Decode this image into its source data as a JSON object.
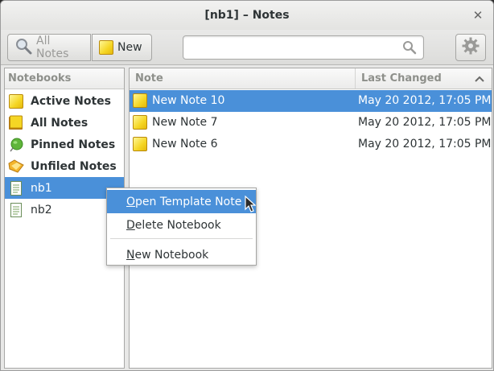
{
  "window": {
    "title": "[nb1] – Notes",
    "close_label": "✕"
  },
  "toolbar": {
    "all_notes_label": "All Notes",
    "new_label": "New",
    "search": {
      "value": "",
      "placeholder": ""
    }
  },
  "notebooks": {
    "header": "Notebooks",
    "items": [
      {
        "label": "Active Notes",
        "icon": "note-icon",
        "bold": true,
        "selected": false
      },
      {
        "label": "All Notes",
        "icon": "notebook-icon",
        "bold": true,
        "selected": false
      },
      {
        "label": "Pinned Notes",
        "icon": "pin-icon",
        "bold": true,
        "selected": false
      },
      {
        "label": "Unfiled Notes",
        "icon": "folder-icon",
        "bold": true,
        "selected": false
      },
      {
        "label": "nb1",
        "icon": "notebook-doc-icon",
        "bold": false,
        "selected": true
      },
      {
        "label": "nb2",
        "icon": "notebook-doc-icon",
        "bold": false,
        "selected": false
      }
    ]
  },
  "notes": {
    "columns": {
      "note": "Note",
      "last_changed": "Last Changed"
    },
    "sort": "descending",
    "rows": [
      {
        "title": "New Note 10",
        "date": "May 20 2012, 17:05 PM",
        "selected": true
      },
      {
        "title": "New Note 7",
        "date": "May 20 2012, 17:05 PM",
        "selected": false
      },
      {
        "title": "New Note 6",
        "date": "May 20 2012, 17:05 PM",
        "selected": false
      }
    ]
  },
  "context_menu": {
    "items": [
      {
        "mnemonic": "O",
        "rest": "pen Template Note",
        "highlighted": true
      },
      {
        "mnemonic": "D",
        "rest": "elete Notebook",
        "highlighted": false
      },
      {
        "mnemonic": "N",
        "rest": "ew Notebook",
        "highlighted": false
      }
    ]
  },
  "colors": {
    "selection": "#4a90d9",
    "note_yellow": "#f5d624"
  }
}
